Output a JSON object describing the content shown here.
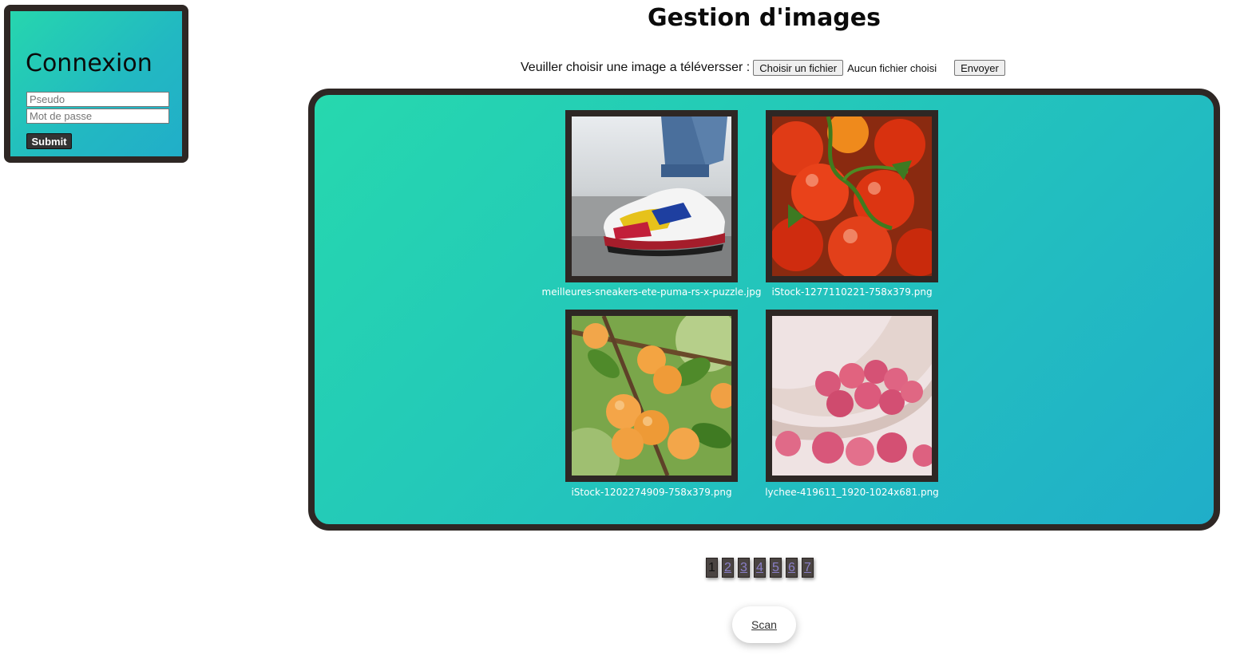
{
  "login": {
    "title": "Connexion",
    "username_placeholder": "Pseudo",
    "password_placeholder": "Mot de passe",
    "submit_label": "Submit"
  },
  "header": {
    "title": "Gestion d'images"
  },
  "upload": {
    "prompt": "Veuiller choisir une image a téléversser :",
    "choose_label": "Choisir un fichier",
    "no_file": "Aucun fichier choisi",
    "send_label": "Envoyer"
  },
  "gallery": {
    "images": [
      {
        "name": "meilleures-sneakers-ete-puma-rs-x-puzzle.jpg",
        "subject": "sneakers"
      },
      {
        "name": "iStock-1277110221-758x379.png",
        "subject": "tomatoes"
      },
      {
        "name": "iStock-1202274909-758x379.png",
        "subject": "apricots"
      },
      {
        "name": "lychee-419611_1920-1024x681.png",
        "subject": "lychees"
      }
    ]
  },
  "pagination": {
    "pages": [
      "1",
      "2",
      "3",
      "4",
      "5",
      "6",
      "7"
    ],
    "current": "1"
  },
  "scan": {
    "label": "Scan"
  },
  "colors": {
    "frame": "#2e2724",
    "gradient_start": "#26d8ae",
    "gradient_end": "#20aec9"
  }
}
